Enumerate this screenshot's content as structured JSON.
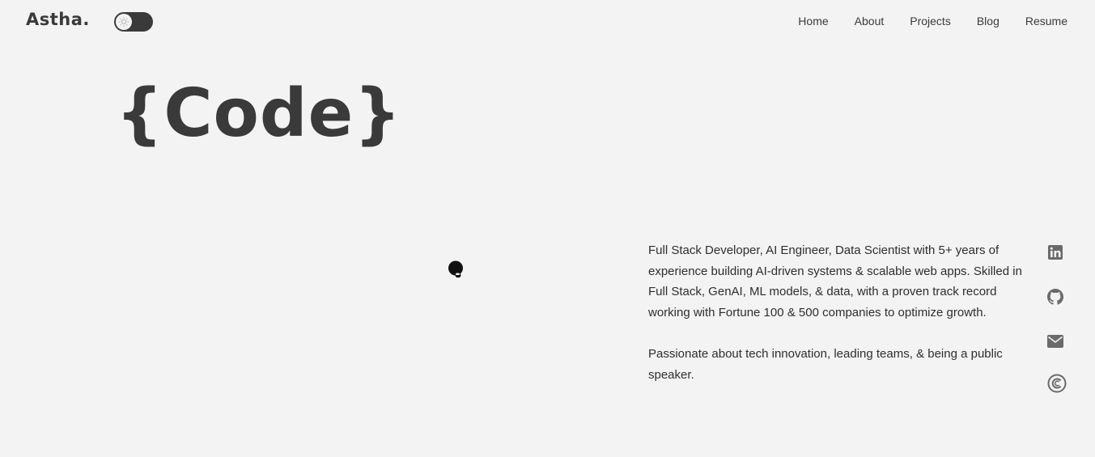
{
  "header": {
    "logo": "Astha.",
    "theme_toggle": "theme-toggle"
  },
  "nav": {
    "items": [
      "Home",
      "About",
      "Projects",
      "Blog",
      "Resume"
    ]
  },
  "hero": {
    "title": "{Code}"
  },
  "bio": {
    "paragraph1": "Full Stack Developer, AI Engineer, Data Scientist with 5+ years of experience building AI-driven systems & scalable web apps. Skilled in Full Stack, GenAI, ML models, & data, with a proven track record working with Fortune 100 & 500 companies to optimize growth.",
    "paragraph2": "Passionate about tech innovation, leading teams, & being a public speaker."
  },
  "social": {
    "icons": [
      "linkedin-icon",
      "github-icon",
      "email-icon",
      "calendly-icon"
    ]
  },
  "colors": {
    "background": "#f3f3f3",
    "text": "#3a3a3a",
    "icon": "#6a6a6a",
    "blob": "#111111"
  }
}
